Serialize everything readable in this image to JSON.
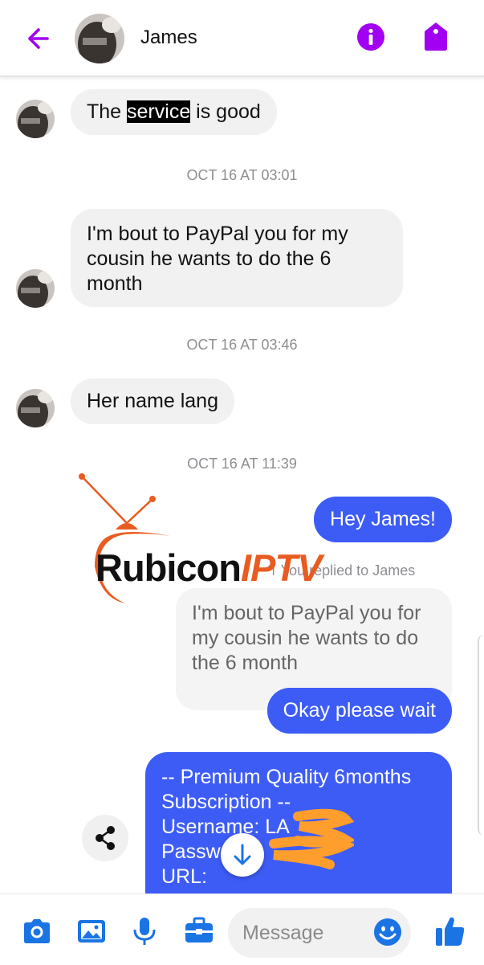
{
  "header": {
    "contact_name": "James",
    "back_icon": "back-arrow-icon",
    "info_icon": "info-icon",
    "tag_icon": "tag-icon",
    "accent_color": "#a100f2"
  },
  "messages": {
    "m1_before": "The ",
    "m1_highlight": "service",
    "m1_after": " is good",
    "stamp1": "OCT 16 AT 03:01",
    "m2_lines": [
      "I'm bout to PayPal you for my",
      "cousin he wants to do the 6",
      "month"
    ],
    "stamp2": "OCT 16 AT 03:46",
    "m3": "Her name lang",
    "stamp3": "OCT 16 AT 11:39",
    "out1": "Hey James!",
    "reply_note": "You replied to James",
    "quoted_lines": [
      "I'm bout to PayPal you for",
      "my cousin he wants to do",
      "the 6 month"
    ],
    "out2": "Okay please wait",
    "out3_lines": [
      "-- Premium Quality 6months",
      "Subscription --",
      "Username: LA",
      "Passw          9",
      "URL:"
    ],
    "outgoing_color": "#3d5cf6",
    "incoming_color": "#f1f1f1"
  },
  "watermark": {
    "brand_main": "Rubicon",
    "brand_accent": "IPTV",
    "accent_color": "#e85c22"
  },
  "composer": {
    "placeholder": "Message",
    "icons": [
      "camera-icon",
      "image-icon",
      "microphone-icon",
      "briefcase-icon",
      "emoji-icon",
      "thumbs-up-icon"
    ],
    "icon_color": "#1b74e4"
  }
}
